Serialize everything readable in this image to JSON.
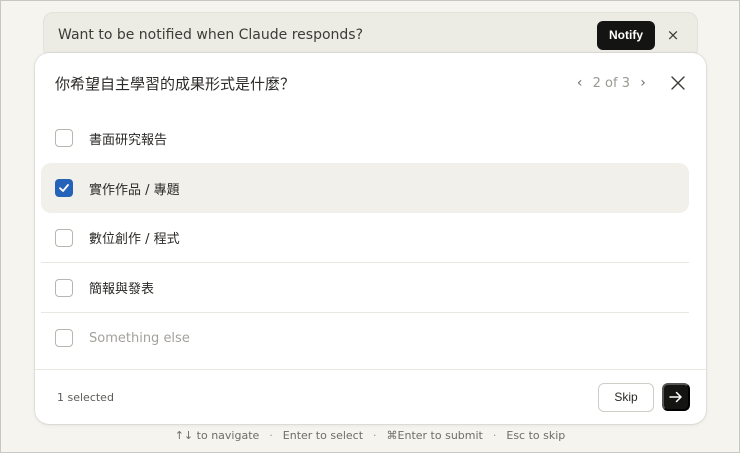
{
  "banner": {
    "text": "Want to be notified when Claude responds?",
    "notify_label": "Notify",
    "close_glyph": "×"
  },
  "question": {
    "text": "你希望自主學習的成果形式是什麼？",
    "pager": {
      "prev_glyph": "‹",
      "count": "2 of 3",
      "next_glyph": "›"
    }
  },
  "options": [
    {
      "label": "書面研究報告",
      "checked": false
    },
    {
      "label": "實作作品 / 專題",
      "checked": true
    },
    {
      "label": "數位創作 / 程式",
      "checked": false
    },
    {
      "label": "簡報與發表",
      "checked": false
    },
    {
      "label": "Something else",
      "checked": false,
      "placeholder": true
    }
  ],
  "footer": {
    "selected_text": "1 selected",
    "skip_label": "Skip"
  },
  "hints": {
    "navigate": "↑↓ to navigate",
    "select": "Enter to select",
    "submit": "⌘Enter to submit",
    "skip": "Esc to skip",
    "separator": "·"
  },
  "colors": {
    "background": "#f5f4ef",
    "accent_check": "#2563b8",
    "button_dark": "#141413"
  }
}
